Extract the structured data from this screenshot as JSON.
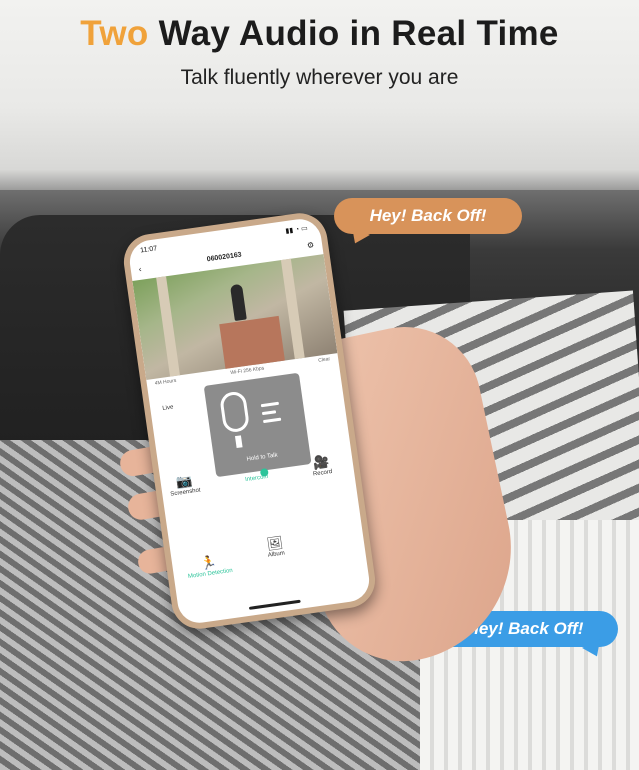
{
  "header": {
    "title_accent": "Two",
    "title_rest": " Way Audio in Real Time",
    "subtitle": "Talk fluently wherever you are"
  },
  "bubbles": {
    "orange_text": "Hey! Back Off!",
    "blue_text": "Hey! Back Off!"
  },
  "phone": {
    "time": "11:07",
    "device_id": "060020163",
    "camera_info_left": "4M Hours",
    "camera_info_mid": "Wi-Fi 256 Kbps",
    "camera_info_right": "Clear",
    "live_label": "Live",
    "overlay_hold": "Hold to Talk",
    "controls": {
      "screenshot": "Screenshot",
      "intercom": "Intercom",
      "record": "Record",
      "motion": "Motion Detection",
      "album": "Album"
    },
    "colors": {
      "accent": "#2cc49a"
    }
  },
  "colors": {
    "title_accent": "#f0a23a",
    "bubble_orange": "#d8935a",
    "bubble_blue": "#3b9de6"
  }
}
